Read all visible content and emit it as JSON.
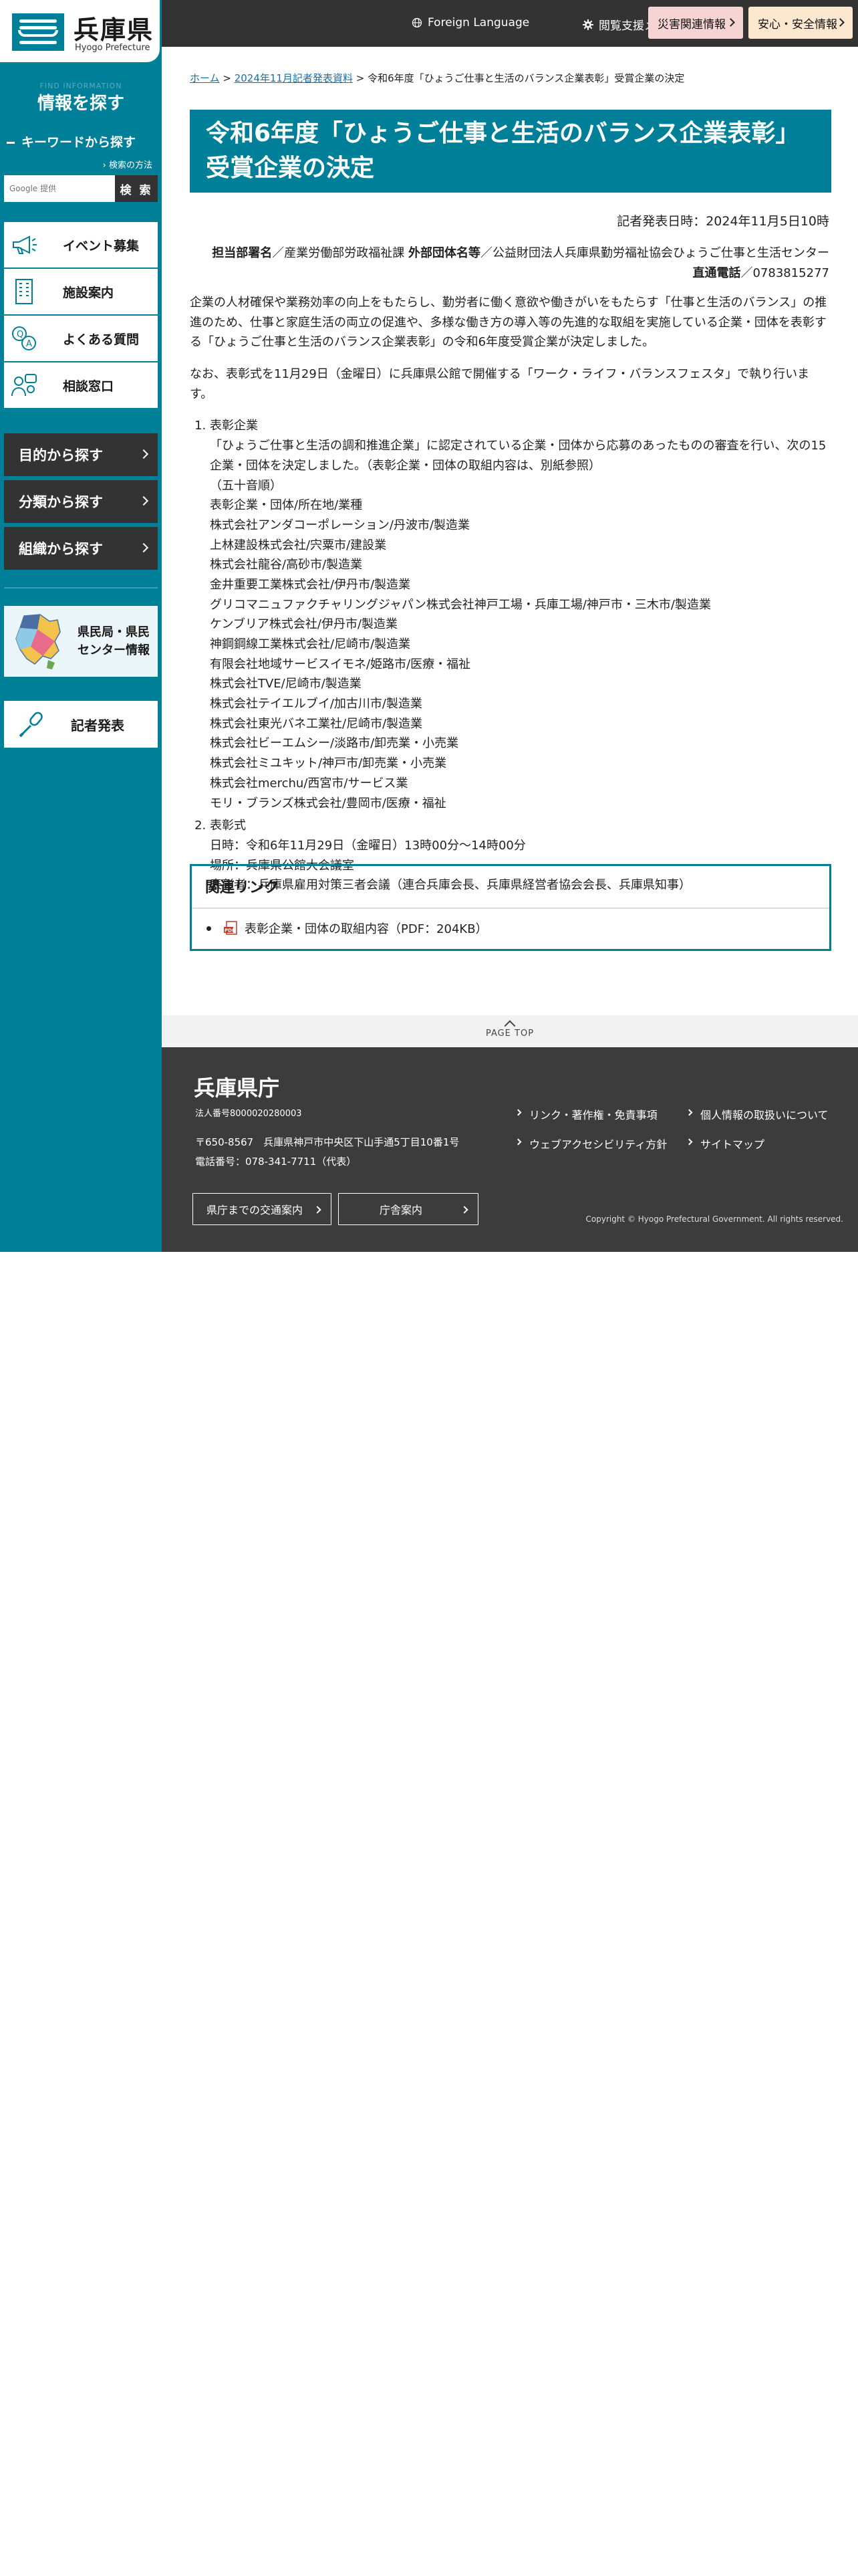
{
  "site": {
    "logo_title": "兵庫県",
    "logo_sub": "Hyogo Prefecture"
  },
  "sidebar": {
    "ghost_text": "FIND INFORMATION",
    "find_title": "情報を探す",
    "keyword_title": "キーワードから探す",
    "search_howto": "検索の方法",
    "search_placeholder": "Google 提供",
    "search_button": "検 索",
    "quick_links": [
      {
        "label": "イベント募集",
        "icon": "megaphone-icon"
      },
      {
        "label": "施設案内",
        "icon": "building-icon"
      },
      {
        "label": "よくある質問",
        "icon": "qa-icon"
      },
      {
        "label": "相談窓口",
        "icon": "consultation-icon"
      }
    ],
    "nav_buttons": [
      {
        "label": "目的から探す"
      },
      {
        "label": "分類から探す"
      },
      {
        "label": "組織から探す"
      }
    ],
    "center_banner": "県民局・県民\nセンター情報",
    "press_banner": "記者発表"
  },
  "topbar": {
    "foreign_language": "Foreign Language",
    "accessibility_menu": "閲覧支援メニュー",
    "disaster_info": "災害関連情報",
    "safety_info": "安心・安全情報",
    "colors": {
      "disaster": "#f6d4d4",
      "safety": "#fbe8cf"
    }
  },
  "breadcrumb": {
    "home": "ホーム",
    "parent": "2024年11月記者発表資料",
    "current": "令和6年度「ひょうご仕事と生活のバランス企業表彰」受賞企業の決定"
  },
  "article": {
    "title": "令和6年度「ひょうご仕事と生活のバランス企業表彰」受賞企業の決定",
    "pub_date": "記者発表日時：2024年11月5日10時",
    "dept_label": "担当部署名",
    "dept_value": "／産業労働部労政福祉課 ",
    "ext_label": "外部団体名等",
    "ext_value": "／公益財団法人兵庫県勤労福祉協会ひょうご仕事と生活センター",
    "phone_label": "直通電話",
    "phone_value": "／0783815277",
    "intro": "企業の人材確保や業務効率の向上をもたらし、勤労者に働く意欲や働きがいをもたらす「仕事と生活のバランス」の推進のため、仕事と家庭生活の両立の促進や、多様な働き方の導入等の先進的な取組を実施している企業・団体を表彰する「ひょうご仕事と生活のバランス企業表彰」の令和6年度受賞企業が決定しました。",
    "note": "なお、表彰式を11月29日（金曜日）に兵庫県公館で開催する「ワーク・ライフ・バランスフェスタ」で執り行います。",
    "item1_title": "表彰企業",
    "item1_lines": [
      "「ひょうご仕事と生活の調和推進企業」に認定されている企業・団体から応募のあったものの審査を行い、次の15",
      "企業・団体を決定しました。（表彰企業・団体の取組内容は、別紙参照）",
      "（五十音順）",
      "表彰企業・団体/所在地/業種",
      "株式会社アンダコーポレーション/丹波市/製造業",
      "上林建設株式会社/宍粟市/建設業",
      "株式会社龍谷/高砂市/製造業",
      "金井重要工業株式会社/伊丹市/製造業",
      "グリコマニュファクチャリングジャパン株式会社神戸工場・兵庫工場/神戸市・三木市/製造業",
      "ケンブリア株式会社/伊丹市/製造業",
      "神鋼鋼線工業株式会社/尼崎市/製造業",
      "有限会社地域サービスイモネ/姫路市/医療・福祉",
      "株式会社TVE/尼崎市/製造業",
      "株式会社テイエルブイ/加古川市/製造業",
      "株式会社東光バネ工業社/尼崎市/製造業",
      "株式会社ビーエムシー/淡路市/卸売業・小売業",
      "株式会社ミユキット/神戸市/卸売業・小売業",
      "株式会社merchu/西宮市/サービス業",
      "モリ・ブランズ株式会社/豊岡市/医療・福祉"
    ],
    "item2_title": "表彰式",
    "item2_lines": [
      "日時：令和6年11月29日（金曜日）13時00分～14時00分",
      "場所：兵庫県公館大会議室",
      "表彰者：兵庫県雇用対策三者会議（連合兵庫会長、兵庫県経営者協会会長、兵庫県知事）"
    ]
  },
  "related": {
    "heading": "関連リンク",
    "items": [
      {
        "label": "表彰企業・団体の取組内容（PDF：204KB）",
        "icon": "pdf-icon"
      }
    ]
  },
  "pagetop": "PAGE TOP",
  "footer": {
    "name": "兵庫県庁",
    "corp_number": "法人番号8000020280003",
    "address": "〒650-8567　兵庫県神戸市中央区下山手通5丁目10番1号",
    "phone": "電話番号：078-341-7711（代表）",
    "btn_access": "県庁までの交通案内",
    "btn_guide": "庁舎案内",
    "links": [
      "リンク・著作権・免責事項",
      "個人情報の取扱いについて",
      "ウェブアクセシビリティ方針",
      "サイトマップ"
    ],
    "copyright": "Copyright © Hyogo Prefectural Government. All rights reserved."
  }
}
